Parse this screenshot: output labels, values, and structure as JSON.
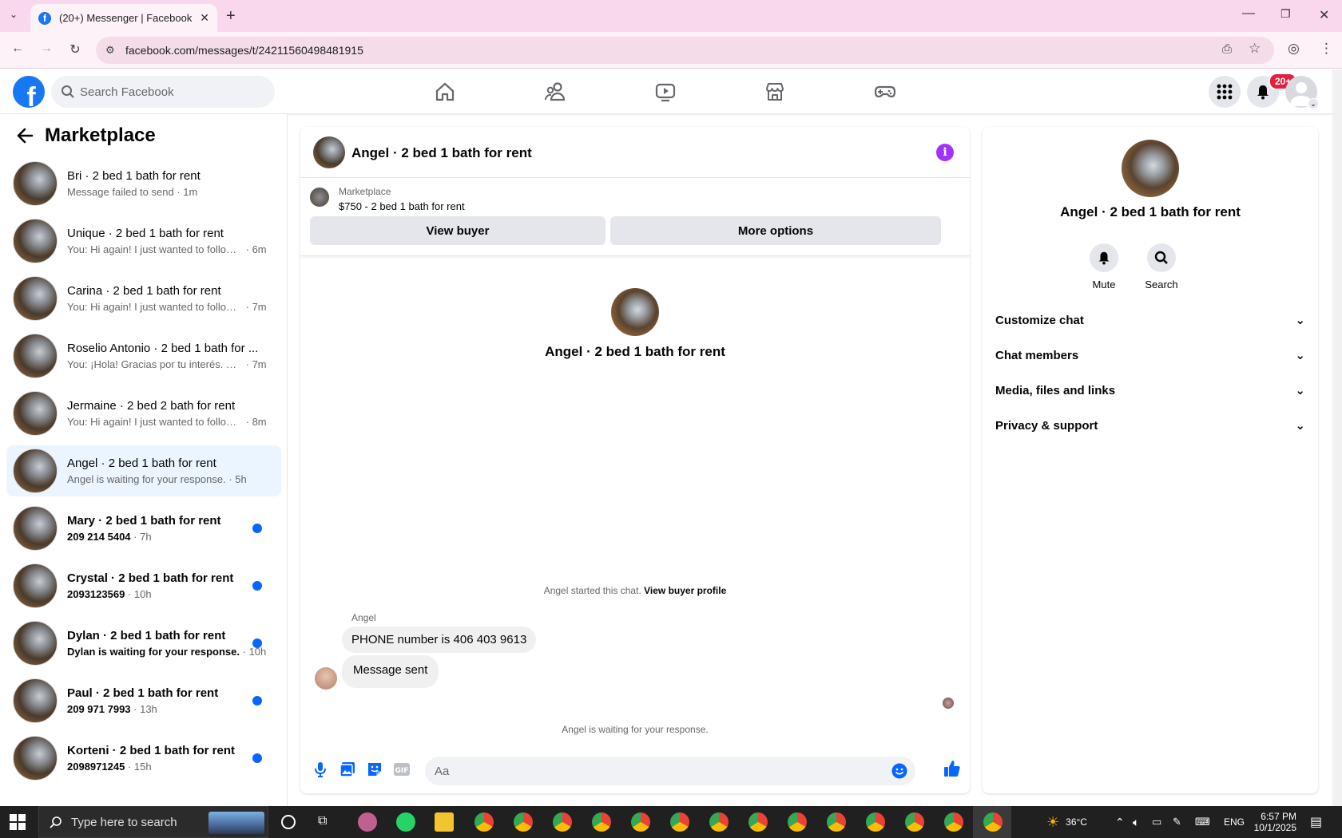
{
  "browser": {
    "tab_title": "(20+) Messenger | Facebook",
    "url": "facebook.com/messages/t/24211560498481915"
  },
  "header": {
    "search_placeholder": "Search Facebook",
    "notification_badge": "20+"
  },
  "sidebar": {
    "title": "Marketplace",
    "conversations": [
      {
        "name": "Bri · 2 bed 1 bath for rent",
        "preview": "Message failed to send",
        "time": "1m",
        "unread": false,
        "active": false
      },
      {
        "name": "Unique · 2 bed 1 bath for rent",
        "preview": "You: Hi again! I just wanted to follow ...",
        "time": "6m",
        "unread": false,
        "active": false
      },
      {
        "name": "Carina · 2 bed 1 bath for rent",
        "preview": "You: Hi again! I just wanted to follow ...",
        "time": "7m",
        "unread": false,
        "active": false
      },
      {
        "name": "Roselio Antonio · 2 bed 1 bath for ...",
        "preview": "You: ¡Hola! Gracias por tu interés. Sí, l...",
        "time": "7m",
        "unread": false,
        "active": false
      },
      {
        "name": "Jermaine · 2 bed 2 bath for rent",
        "preview": "You: Hi again! I just wanted to follow ...",
        "time": "8m",
        "unread": false,
        "active": false
      },
      {
        "name": "Angel · 2 bed 1 bath for rent",
        "preview": "Angel is waiting for your response.",
        "time": "5h",
        "unread": false,
        "active": true
      },
      {
        "name": "Mary · 2 bed 1 bath for rent",
        "preview": "209 214 5404",
        "time": "7h",
        "unread": true,
        "active": false
      },
      {
        "name": "Crystal · 2 bed 1 bath for rent",
        "preview": "2093123569",
        "time": "10h",
        "unread": true,
        "active": false
      },
      {
        "name": "Dylan · 2 bed 1 bath for rent",
        "preview": "Dylan is waiting for your response.",
        "time": "10h",
        "unread": true,
        "active": false
      },
      {
        "name": "Paul · 2 bed 1 bath for rent",
        "preview": "209 971 7993",
        "time": "13h",
        "unread": true,
        "active": false
      },
      {
        "name": "Korteni · 2 bed 1 bath for rent",
        "preview": "2098971245",
        "time": "15h",
        "unread": true,
        "active": false
      }
    ]
  },
  "chat": {
    "title": "Angel · 2 bed 1 bath for rent",
    "marketplace_label": "Marketplace",
    "listing": "$750 - 2 bed 1 bath for rent",
    "view_buyer": "View buyer",
    "more_options": "More options",
    "profile_name": "Angel · 2 bed 1 bath for rent",
    "started_text": "Angel started this chat.",
    "view_buyer_profile": "View buyer profile",
    "sender": "Angel",
    "messages": [
      "PHONE number is 406 403 9613",
      "Message sent"
    ],
    "waiting_text": "Angel is waiting for your response.",
    "input_placeholder": "Aa"
  },
  "right_panel": {
    "name": "Angel · 2 bed 1 bath for rent",
    "mute": "Mute",
    "search": "Search",
    "sections": [
      "Customize chat",
      "Chat members",
      "Media, files and links",
      "Privacy & support"
    ]
  },
  "taskbar": {
    "search_placeholder": "Type here to search",
    "temperature": "36°C",
    "language": "ENG",
    "time": "6:57 PM",
    "date": "10/1/2025"
  },
  "colors": {
    "brand": "#1877f2",
    "accent_purple": "#a033ff",
    "unread_dot": "#0866ff",
    "active_row": "#ebf5ff"
  }
}
